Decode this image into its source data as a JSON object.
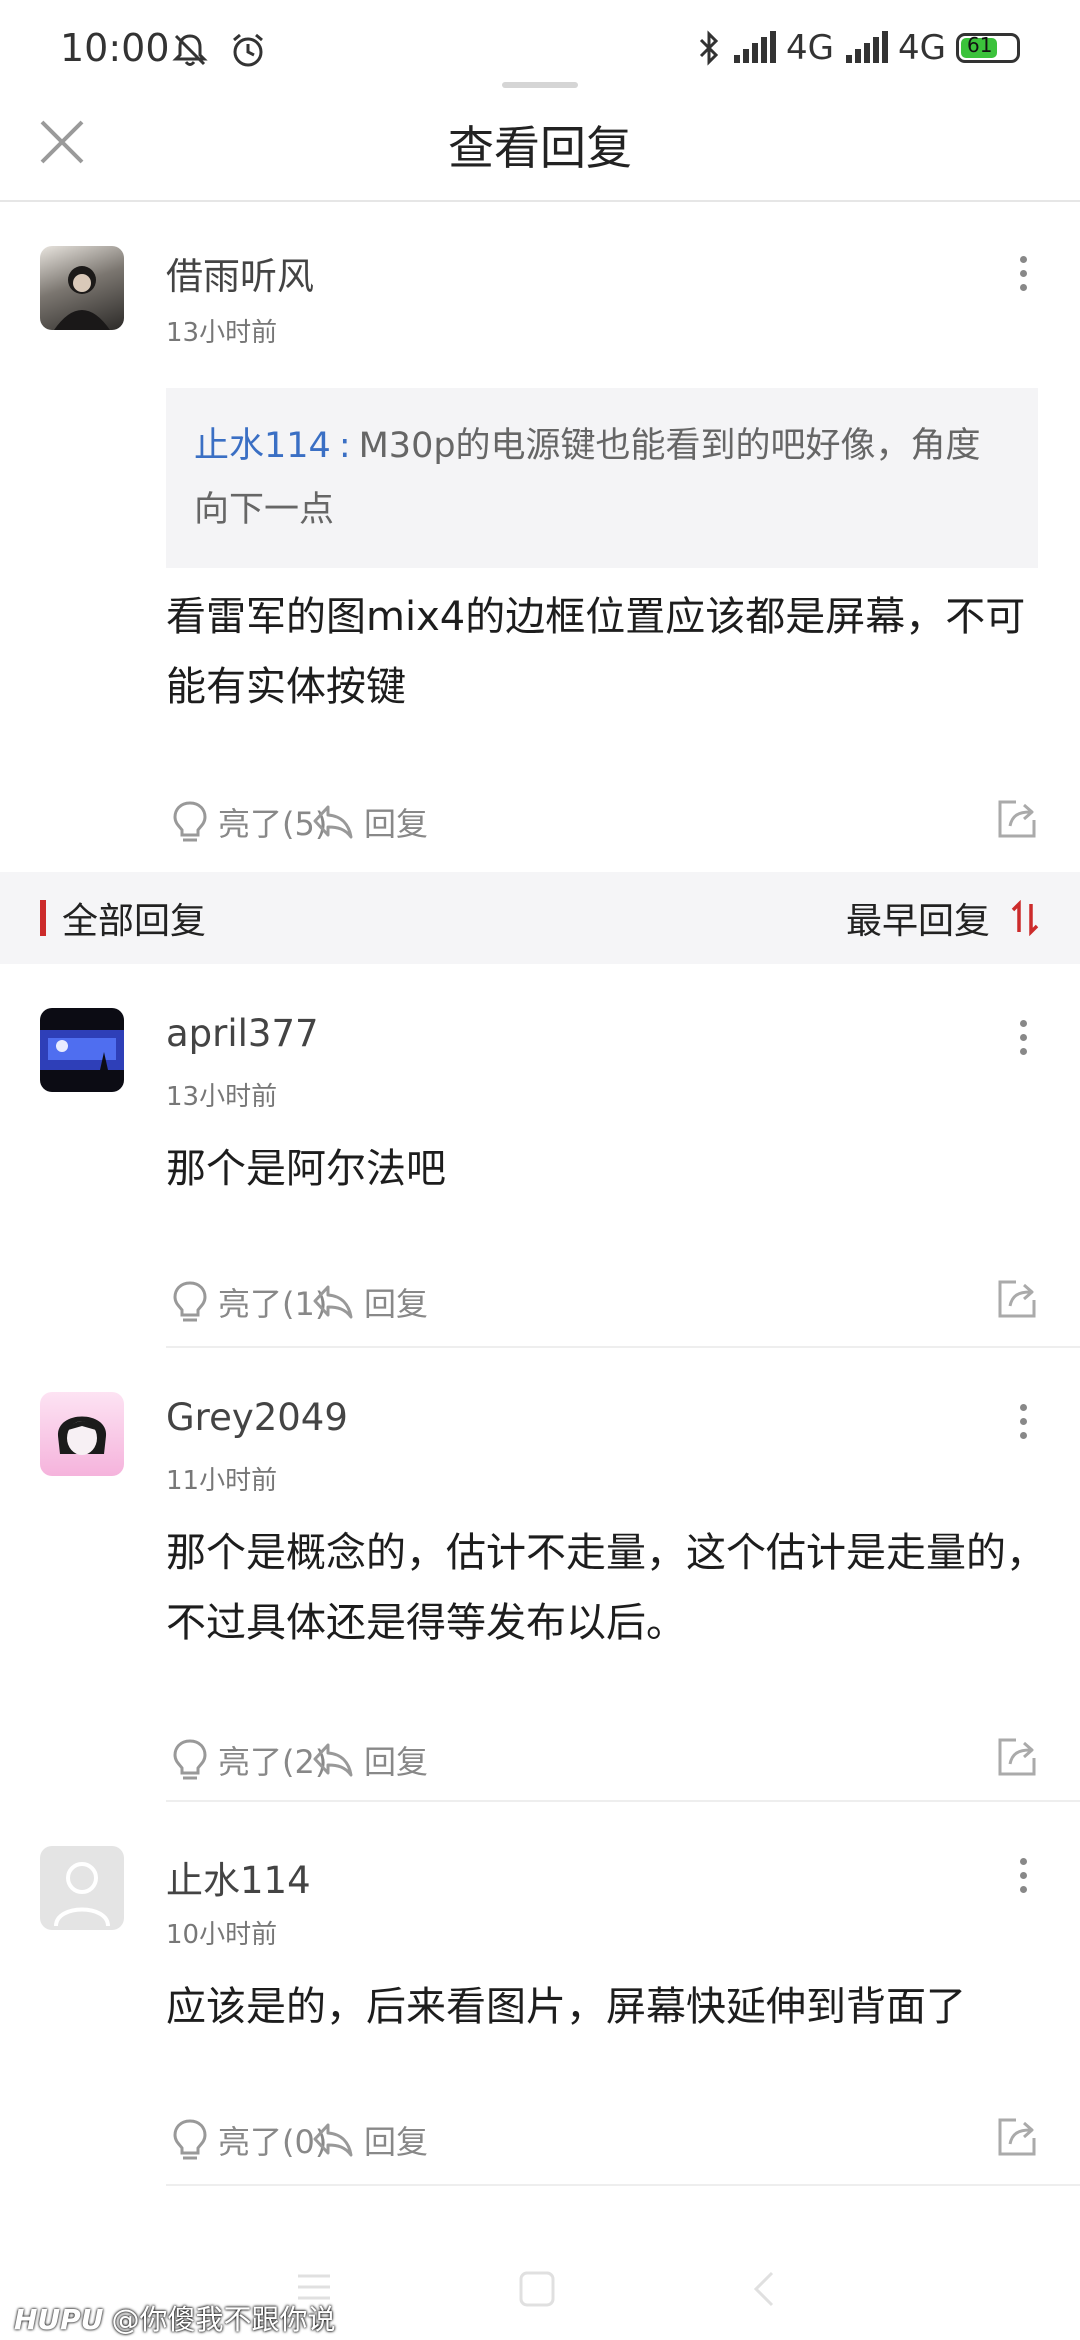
{
  "status_bar": {
    "time": "10:00",
    "network1": "4G",
    "network2": "4G",
    "battery": "61"
  },
  "header": {
    "title": "查看回复"
  },
  "main_comment": {
    "username": "借雨听风",
    "time": "13小时前",
    "quote_user": "止水114",
    "quote_sep": ":",
    "quote_text": "M30p的电源键也能看到的吧好像，角度向下一点",
    "text": "看雷军的图mix4的边框位置应该都是屏幕，不可能有实体按键",
    "like_label": "亮了(5)",
    "reply_label": "回复"
  },
  "section": {
    "title": "全部回复",
    "sort_label": "最早回复"
  },
  "replies": [
    {
      "username": "april377",
      "time": "13小时前",
      "text": "那个是阿尔法吧",
      "like_label": "亮了(1)",
      "reply_label": "回复"
    },
    {
      "username": "Grey2049",
      "time": "11小时前",
      "text": "那个是概念的，估计不走量，这个估计是走量的，不过具体还是得等发布以后。",
      "like_label": "亮了(2)",
      "reply_label": "回复"
    },
    {
      "username": "止水114",
      "time": "10小时前",
      "text": "应该是的，后来看图片，屏幕快延伸到背面了",
      "like_label": "亮了(0)",
      "reply_label": "回复"
    }
  ],
  "watermark": {
    "brand": "HUPU",
    "text": "@你傻我不跟你说"
  },
  "colors": {
    "accent_red": "#cc2b2b",
    "quote_blue": "#3a6fc4"
  }
}
